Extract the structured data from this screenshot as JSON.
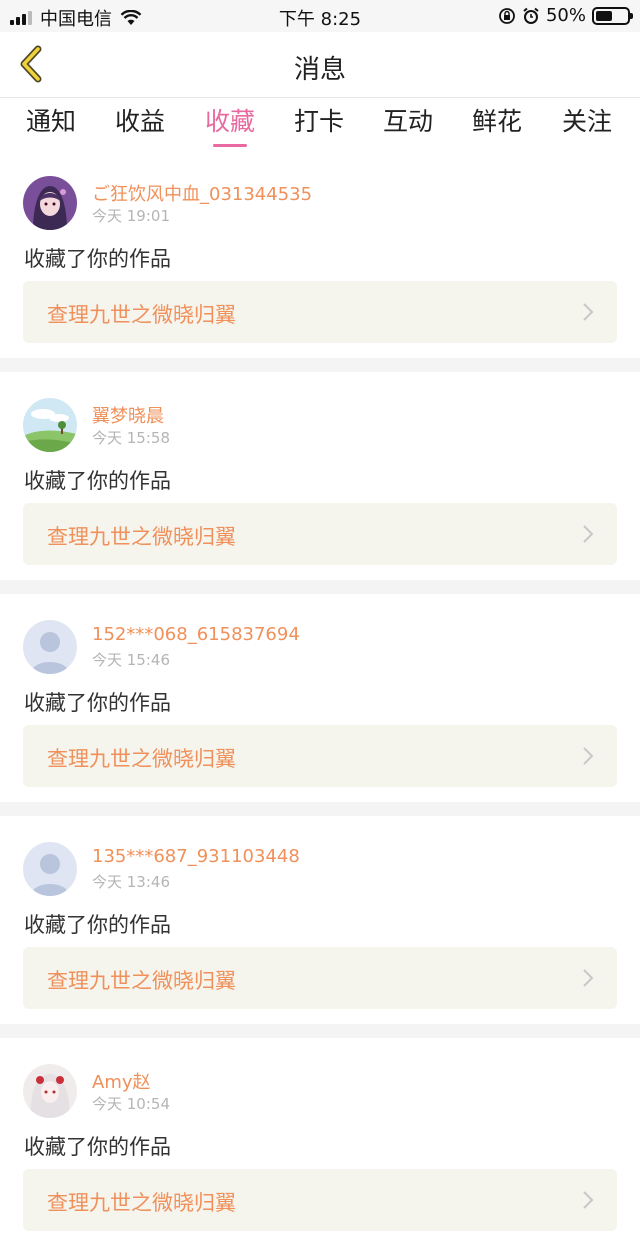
{
  "status_bar": {
    "carrier": "中国电信",
    "time": "下午 8:25",
    "battery_pct": "50%",
    "icons": [
      "signal-icon",
      "wifi-icon",
      "orientation-lock-icon",
      "alarm-icon",
      "battery-icon"
    ]
  },
  "nav": {
    "title": "消息",
    "back_icon": "chevron-left-icon"
  },
  "tabs": [
    {
      "label": "通知"
    },
    {
      "label": "收益"
    },
    {
      "label": "收藏"
    },
    {
      "label": "打卡"
    },
    {
      "label": "互动"
    },
    {
      "label": "鲜花"
    },
    {
      "label": "关注"
    }
  ],
  "active_tab": "收藏",
  "colors": {
    "accent_pink": "#e86aa0",
    "accent_orange": "#f0905a",
    "card_bg": "#f5f5ee"
  },
  "messages": [
    {
      "name": "ご狂饮风中血_031344535",
      "time": "今天 19:01",
      "action": "收藏了你的作品",
      "work": "查理九世之微晓归翼",
      "avatar": "anime-girl-avatar"
    },
    {
      "name": "翼梦晓晨",
      "time": "今天 15:58",
      "action": "收藏了你的作品",
      "work": "查理九世之微晓归翼",
      "avatar": "landscape-avatar"
    },
    {
      "name": "152***068_615837694",
      "time": "今天 15:46",
      "action": "收藏了你的作品",
      "work": "查理九世之微晓归翼",
      "avatar": "default-user-avatar"
    },
    {
      "name": "135***687_931103448",
      "time": "今天 13:46",
      "action": "收藏了你的作品",
      "work": "查理九世之微晓归翼",
      "avatar": "default-user-avatar"
    },
    {
      "name": "Amy赵",
      "time": "今天 10:54",
      "action": "收藏了你的作品",
      "work": "查理九世之微晓归翼",
      "avatar": "white-hair-girl-avatar"
    }
  ]
}
